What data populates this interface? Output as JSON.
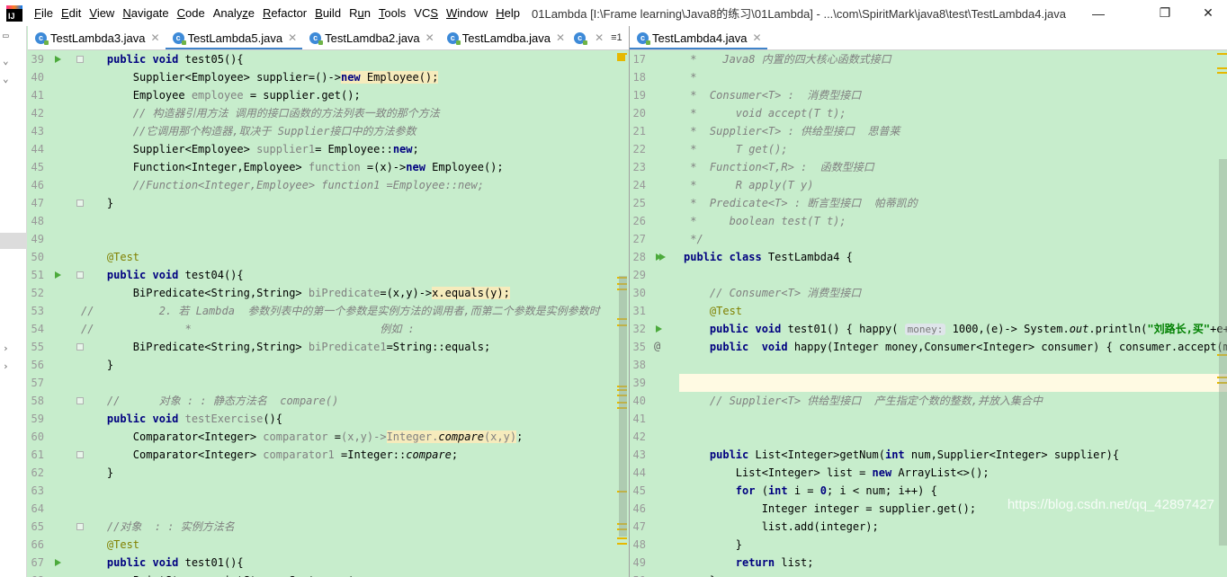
{
  "window": {
    "title": "01Lambda [I:\\Frame learning\\Java8的练习\\01Lambda] - ...\\com\\SpiritMark\\java8\\test\\TestLambda4.java",
    "logo_text": "IJ",
    "minimize_glyph": "—",
    "maximize_glyph": "❐",
    "close_glyph": "✕"
  },
  "menu": [
    {
      "pre": "",
      "mn": "F",
      "post": "ile"
    },
    {
      "pre": "",
      "mn": "E",
      "post": "dit"
    },
    {
      "pre": "",
      "mn": "V",
      "post": "iew"
    },
    {
      "pre": "",
      "mn": "N",
      "post": "avigate"
    },
    {
      "pre": "",
      "mn": "C",
      "post": "ode"
    },
    {
      "pre": "Analy",
      "mn": "z",
      "post": "e"
    },
    {
      "pre": "",
      "mn": "R",
      "post": "efactor"
    },
    {
      "pre": "",
      "mn": "B",
      "post": "uild"
    },
    {
      "pre": "R",
      "mn": "u",
      "post": "n"
    },
    {
      "pre": "",
      "mn": "T",
      "post": "ools"
    },
    {
      "pre": "VC",
      "mn": "S",
      "post": ""
    },
    {
      "pre": "",
      "mn": "W",
      "post": "indow"
    },
    {
      "pre": "",
      "mn": "H",
      "post": "elp"
    }
  ],
  "left_tabs": [
    {
      "label": "TestLambda3.java",
      "active": false
    },
    {
      "label": "TestLambda5.java",
      "active": true
    },
    {
      "label": "TestLamdba2.java",
      "active": false
    },
    {
      "label": "TestLamdba.java",
      "active": false
    }
  ],
  "left_tab_overflow": "≡1",
  "right_tabs": [
    {
      "label": "TestLambda4.java",
      "active": true
    }
  ],
  "icons": {
    "tab_file": "java-class-icon",
    "tab_close": "close-icon",
    "run": "run-gutter-icon",
    "run_all": "run-class-gutter-icon",
    "fold": "fold-icon",
    "implements": "implements-at-icon"
  },
  "colors": {
    "editor_bg": "#c7edcc",
    "keyword": "#000080",
    "comment": "#808080",
    "annotation": "#808000",
    "string": "#008000",
    "highlight": "#f6ebbc",
    "current_line": "#fffae3",
    "active_tab_underline": "#4083c9",
    "marker": "#e6b800"
  },
  "left_editor": {
    "first_line": 39,
    "lines": [
      {
        "n": "39",
        "code": [
          [
            "    ",
            ""
          ],
          [
            "public void ",
            "kw"
          ],
          [
            "test05(){",
            ""
          ]
        ],
        "run": true
      },
      {
        "n": "40",
        "code": [
          [
            "        Supplier<Employee> supplier=()->",
            ""
          ],
          [
            "new ",
            "kw hl"
          ],
          [
            "Employee();",
            "hl"
          ]
        ]
      },
      {
        "n": "41",
        "code": [
          [
            "        Employee ",
            ""
          ],
          [
            "employee",
            "uv"
          ],
          [
            " = supplier.get();",
            ""
          ]
        ]
      },
      {
        "n": "42",
        "code": [
          [
            "        // 构造器引用方法 调用的接口函数的方法列表一致的那个方法",
            "cm"
          ]
        ]
      },
      {
        "n": "43",
        "code": [
          [
            "        //它调用那个构造器,取决于 Supplier接口中的方法参数",
            "cm"
          ]
        ]
      },
      {
        "n": "44",
        "code": [
          [
            "        Supplier<Employee> ",
            ""
          ],
          [
            "supplier1",
            "uv"
          ],
          [
            "= Employee::",
            ""
          ],
          [
            "new",
            "kw"
          ],
          [
            ";",
            ""
          ]
        ]
      },
      {
        "n": "45",
        "code": [
          [
            "        Function<Integer,Employee> ",
            ""
          ],
          [
            "function",
            "uv"
          ],
          [
            " =(x)->",
            ""
          ],
          [
            "new ",
            "kw"
          ],
          [
            "Employee();",
            ""
          ]
        ]
      },
      {
        "n": "46",
        "code": [
          [
            "        //Function<Integer,Employee> function1 =Employee::new;",
            "cm"
          ]
        ]
      },
      {
        "n": "47",
        "code": [
          [
            "    }",
            ""
          ]
        ]
      },
      {
        "n": "48",
        "code": []
      },
      {
        "n": "49",
        "code": []
      },
      {
        "n": "50",
        "code": [
          [
            "    ",
            ""
          ],
          [
            "@Test",
            "an"
          ]
        ]
      },
      {
        "n": "51",
        "code": [
          [
            "    ",
            ""
          ],
          [
            "public void ",
            "kw"
          ],
          [
            "test04(){",
            ""
          ]
        ],
        "run": true
      },
      {
        "n": "52",
        "code": [
          [
            "        BiPredicate<String,String> ",
            ""
          ],
          [
            "biPredicate",
            "uv"
          ],
          [
            "=(x,y)->",
            ""
          ],
          [
            "x.equals(y);",
            "hl"
          ]
        ]
      },
      {
        "n": "53",
        "code": [
          [
            "//          2. 若 Lambda  参数列表中的第一个参数是实例方法的调用者,而第二个参数是实例参数时",
            "cm"
          ]
        ]
      },
      {
        "n": "54",
        "code": [
          [
            "//              *                             例如 :",
            "cm"
          ]
        ]
      },
      {
        "n": "55",
        "code": [
          [
            "        BiPredicate<String,String> ",
            ""
          ],
          [
            "biPredicate1",
            "uv"
          ],
          [
            "=String::equals;",
            ""
          ]
        ]
      },
      {
        "n": "56",
        "code": [
          [
            "    }",
            ""
          ]
        ]
      },
      {
        "n": "57",
        "code": []
      },
      {
        "n": "58",
        "code": [
          [
            "    //      对象 : : 静态方法名  compare()",
            "cm"
          ]
        ]
      },
      {
        "n": "59",
        "code": [
          [
            "    ",
            ""
          ],
          [
            "public void ",
            "kw"
          ],
          [
            "testExercise",
            "uv"
          ],
          [
            "(){",
            ""
          ]
        ]
      },
      {
        "n": "60",
        "code": [
          [
            "        Comparator<Integer> ",
            ""
          ],
          [
            "comparator",
            "uv"
          ],
          [
            " =",
            ""
          ],
          [
            "(x,y)->",
            "uv"
          ],
          [
            "Integer.",
            "hl uv"
          ],
          [
            "compare",
            "hl fn uv"
          ],
          [
            "(x,y)",
            "hl uv"
          ],
          [
            ";",
            ""
          ]
        ]
      },
      {
        "n": "61",
        "code": [
          [
            "        Comparator<Integer> ",
            ""
          ],
          [
            "comparator1",
            "uv"
          ],
          [
            " =Integer::",
            ""
          ],
          [
            "compare",
            "fn"
          ],
          [
            ";",
            ""
          ]
        ]
      },
      {
        "n": "62",
        "code": [
          [
            "    }",
            ""
          ]
        ]
      },
      {
        "n": "63",
        "code": []
      },
      {
        "n": "64",
        "code": []
      },
      {
        "n": "65",
        "code": [
          [
            "    //对象  : : 实例方法名",
            "cm"
          ]
        ]
      },
      {
        "n": "66",
        "code": [
          [
            "    ",
            ""
          ],
          [
            "@Test",
            "an"
          ]
        ]
      },
      {
        "n": "67",
        "code": [
          [
            "    ",
            ""
          ],
          [
            "public void ",
            "kw"
          ],
          [
            "test01(){",
            ""
          ]
        ],
        "run": true
      },
      {
        "n": "68",
        "code": [
          [
            "        PrintStream printStream=System.",
            ""
          ],
          [
            "out",
            "fn"
          ],
          [
            ";",
            ""
          ]
        ]
      }
    ]
  },
  "right_editor": {
    "lines": [
      {
        "n": "17",
        "code": [
          [
            " *    Java8 内置的四大核心函数式接口",
            "cm"
          ]
        ]
      },
      {
        "n": "18",
        "code": [
          [
            " *",
            "cm"
          ]
        ]
      },
      {
        "n": "19",
        "code": [
          [
            " *  Consumer<T> :  消费型接口",
            "cm"
          ]
        ]
      },
      {
        "n": "20",
        "code": [
          [
            " *      void accept(T t);",
            "cm"
          ]
        ]
      },
      {
        "n": "21",
        "code": [
          [
            " *  Supplier<T> : 供给型接口  思普莱",
            "cm"
          ]
        ]
      },
      {
        "n": "22",
        "code": [
          [
            " *      T get();",
            "cm"
          ]
        ]
      },
      {
        "n": "23",
        "code": [
          [
            " *  Function<T,R> :  函数型接口",
            "cm"
          ]
        ]
      },
      {
        "n": "24",
        "code": [
          [
            " *      R apply(T y)",
            "cm"
          ]
        ]
      },
      {
        "n": "25",
        "code": [
          [
            " *  Predicate<T> : 断言型接口  帕蒂凯的",
            "cm"
          ]
        ]
      },
      {
        "n": "26",
        "code": [
          [
            " *     boolean test(T t);",
            "cm"
          ]
        ]
      },
      {
        "n": "27",
        "code": [
          [
            " */",
            "cm"
          ]
        ]
      },
      {
        "n": "28",
        "code": [
          [
            "public class ",
            "kw"
          ],
          [
            "TestLambda4 {",
            ""
          ]
        ],
        "runall": true
      },
      {
        "n": "29",
        "code": []
      },
      {
        "n": "30",
        "code": [
          [
            "    // Consumer<T> 消费型接口",
            "cm"
          ]
        ]
      },
      {
        "n": "31",
        "code": [
          [
            "    ",
            ""
          ],
          [
            "@Test",
            "an"
          ]
        ]
      },
      {
        "n": "32",
        "code": [
          [
            "    ",
            ""
          ],
          [
            "public void ",
            "kw"
          ],
          [
            "test01() { happy( ",
            ""
          ],
          [
            "money:",
            "hint"
          ],
          [
            " 1000",
            ""
          ],
          [
            ",(e)-> System.",
            ""
          ],
          [
            "out",
            "fn"
          ],
          [
            ".println(",
            ""
          ],
          [
            "\"刘路长,买\"",
            "st"
          ],
          [
            "+e+",
            ""
          ],
          [
            "\"元",
            "st"
          ]
        ],
        "run": true
      },
      {
        "n": "35",
        "code": [
          [
            "    ",
            ""
          ],
          [
            "public  void ",
            "kw"
          ],
          [
            "happy(Integer money,Consumer<Integer> consumer) { consumer.accept(mone",
            ""
          ]
        ],
        "at": true
      },
      {
        "n": "38",
        "code": []
      },
      {
        "n": "39",
        "code": [],
        "current": true
      },
      {
        "n": "40",
        "code": [
          [
            "    // Supplier<T> 供给型接口  产生指定个数的整数,并放入集合中",
            "cm"
          ]
        ]
      },
      {
        "n": "41",
        "code": []
      },
      {
        "n": "42",
        "code": []
      },
      {
        "n": "43",
        "code": [
          [
            "    ",
            ""
          ],
          [
            "public ",
            "kw"
          ],
          [
            "List<Integer>getNum(",
            ""
          ],
          [
            "int ",
            "kw"
          ],
          [
            "num,Supplier<Integer> supplier){",
            ""
          ]
        ]
      },
      {
        "n": "44",
        "code": [
          [
            "        List<Integer> list = ",
            ""
          ],
          [
            "new ",
            "kw"
          ],
          [
            "ArrayList<>();",
            ""
          ]
        ]
      },
      {
        "n": "45",
        "code": [
          [
            "        ",
            ""
          ],
          [
            "for ",
            "kw"
          ],
          [
            "(",
            ""
          ],
          [
            "int ",
            "kw"
          ],
          [
            "i = ",
            ""
          ],
          [
            "0",
            "kw"
          ],
          [
            "; i < num; i++) {",
            ""
          ]
        ]
      },
      {
        "n": "46",
        "code": [
          [
            "            Integer integer = supplier.get();",
            ""
          ]
        ]
      },
      {
        "n": "47",
        "code": [
          [
            "            list.add(integer);",
            ""
          ]
        ]
      },
      {
        "n": "48",
        "code": [
          [
            "        }",
            ""
          ]
        ]
      },
      {
        "n": "49",
        "code": [
          [
            "        ",
            ""
          ],
          [
            "return ",
            "kw"
          ],
          [
            "list;",
            ""
          ]
        ]
      },
      {
        "n": "50",
        "code": [
          [
            "    }",
            ""
          ]
        ]
      }
    ]
  },
  "watermark": "https://blog.csdn.net/qq_42897427"
}
